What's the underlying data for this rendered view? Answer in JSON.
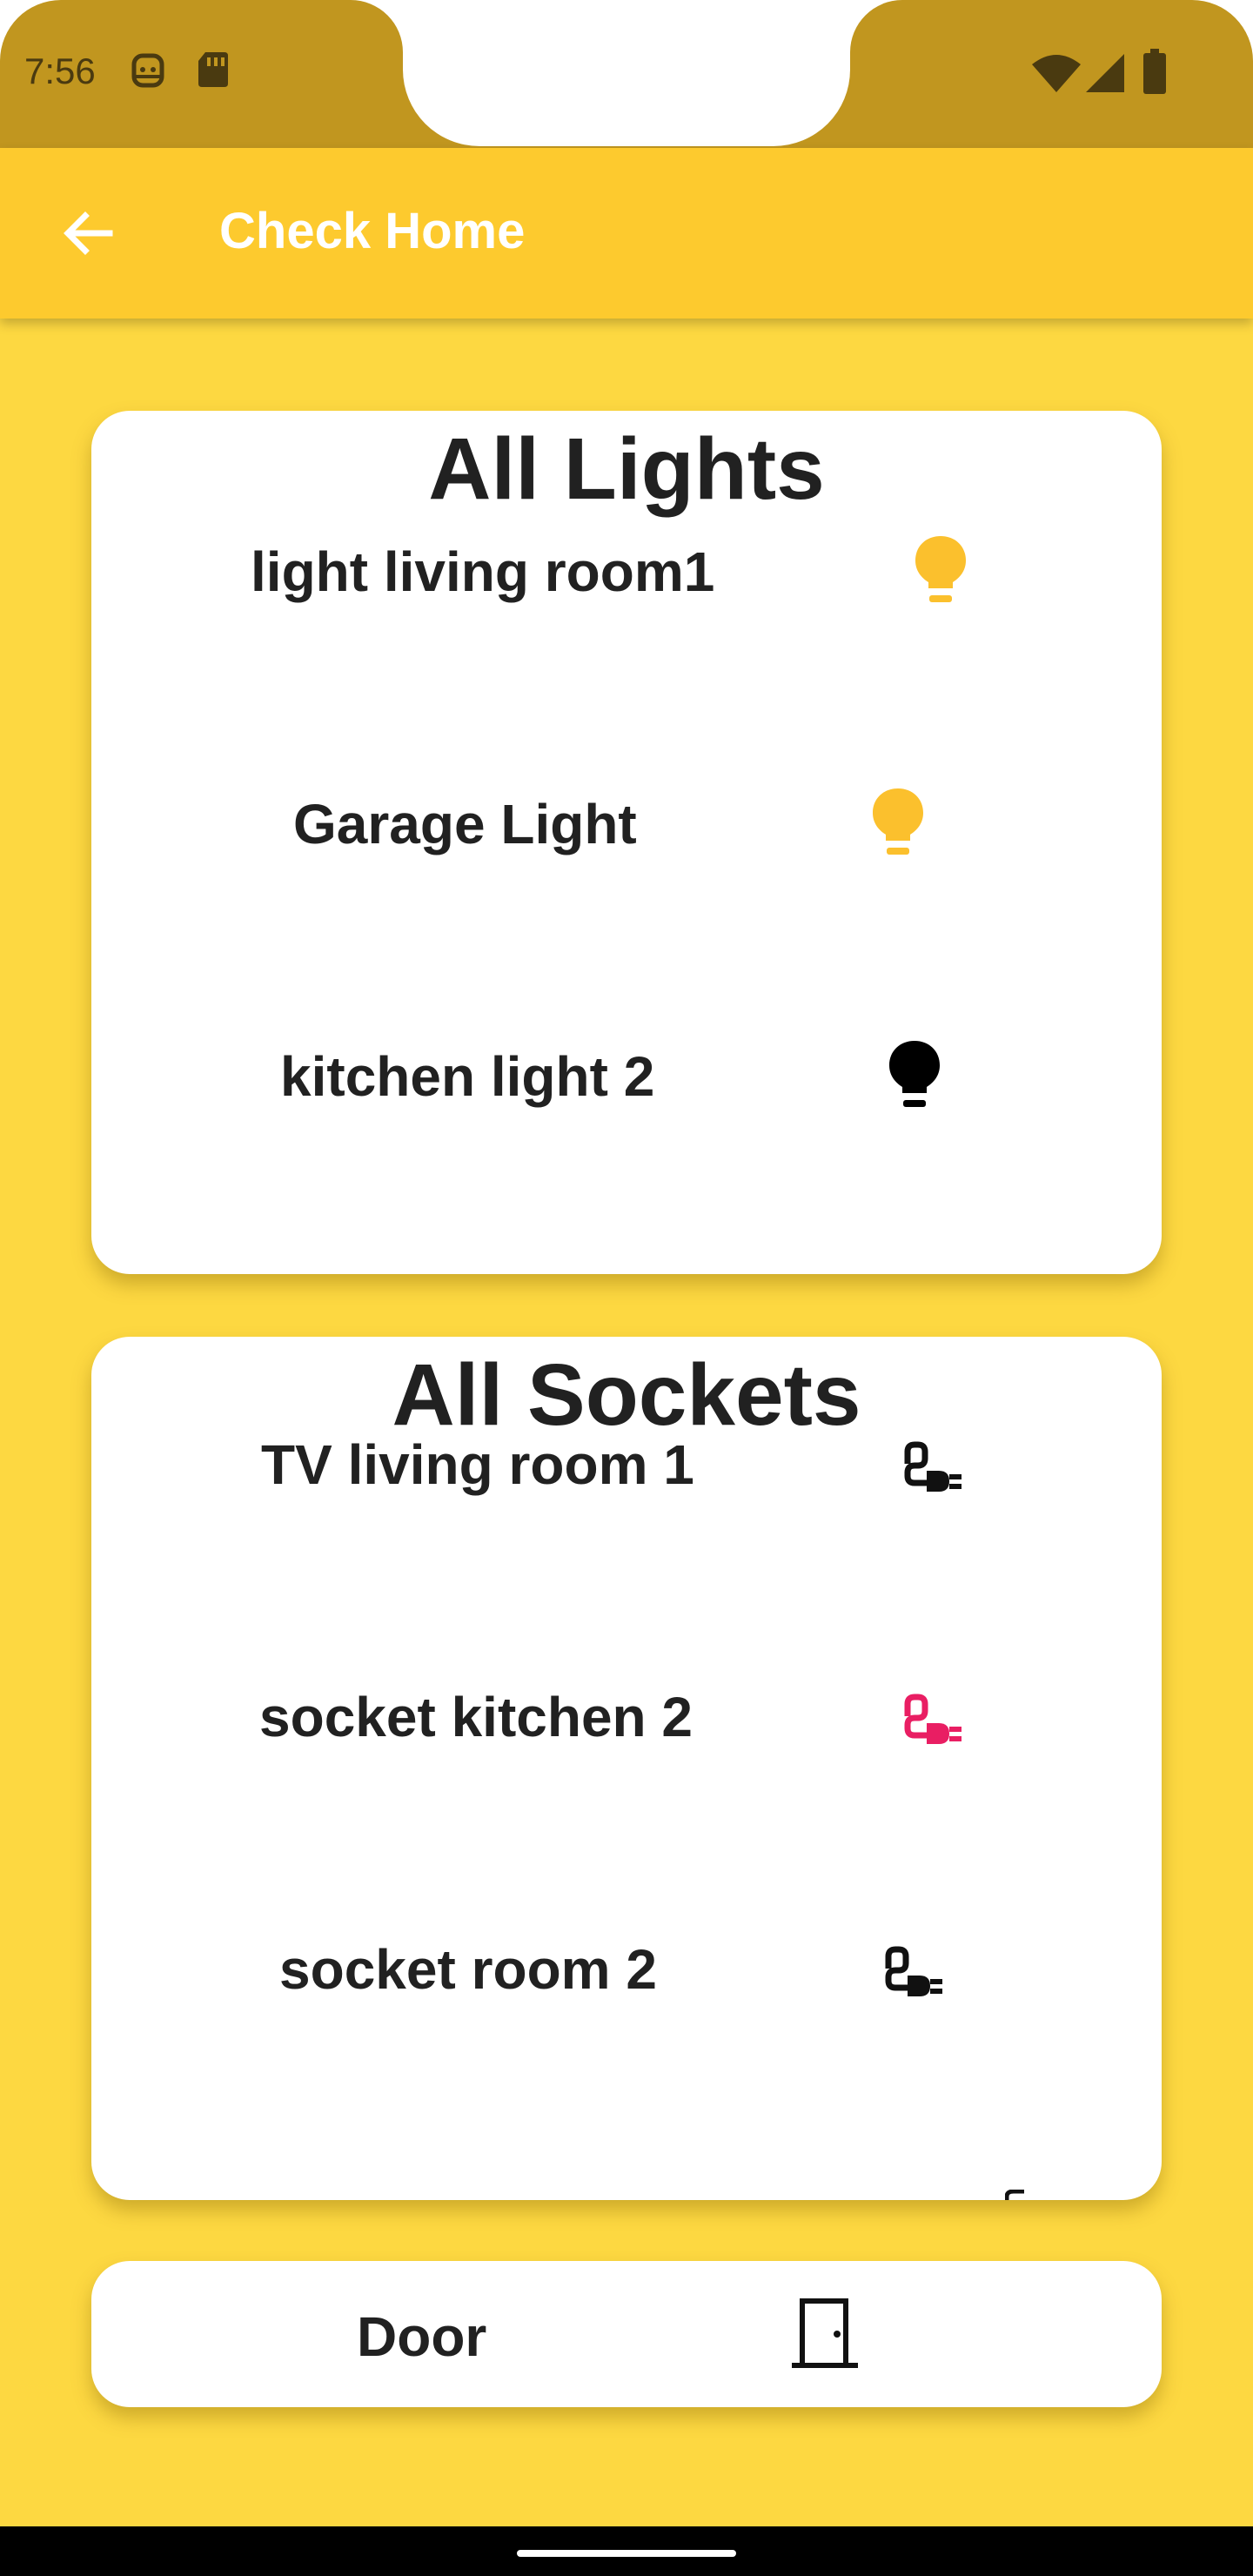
{
  "status_bar": {
    "time": "7:56",
    "icons": [
      "face-icon",
      "sd-card-icon",
      "wifi-icon",
      "signal-icon",
      "battery-icon"
    ]
  },
  "app_bar": {
    "title": "Check Home",
    "back_icon": "arrow-back-icon"
  },
  "lights_card": {
    "title": "All Lights",
    "items": [
      {
        "label": "light living room1",
        "icon": "lightbulb-icon",
        "state": "on",
        "color": "#FBC02D"
      },
      {
        "label": "Garage Light",
        "icon": "lightbulb-icon",
        "state": "on",
        "color": "#FBC02D"
      },
      {
        "label": "kitchen light 2",
        "icon": "lightbulb-icon",
        "state": "off",
        "color": "#000000"
      }
    ]
  },
  "sockets_card": {
    "title": "All Sockets",
    "items": [
      {
        "label": "TV living room 1",
        "icon": "power-plug-icon",
        "state": "off",
        "color": "#111111"
      },
      {
        "label": "socket kitchen 2",
        "icon": "power-plug-icon",
        "state": "on",
        "color": "#E91E63"
      },
      {
        "label": "socket room 2",
        "icon": "power-plug-icon",
        "state": "off",
        "color": "#111111"
      }
    ]
  },
  "door_card": {
    "label": "Door",
    "icon": "door-icon"
  },
  "colors": {
    "background": "#FDD841",
    "app_bar": "#FDCA2E",
    "status_bar": "#C1961F",
    "light_on": "#FBC02D",
    "socket_on": "#E91E63"
  }
}
